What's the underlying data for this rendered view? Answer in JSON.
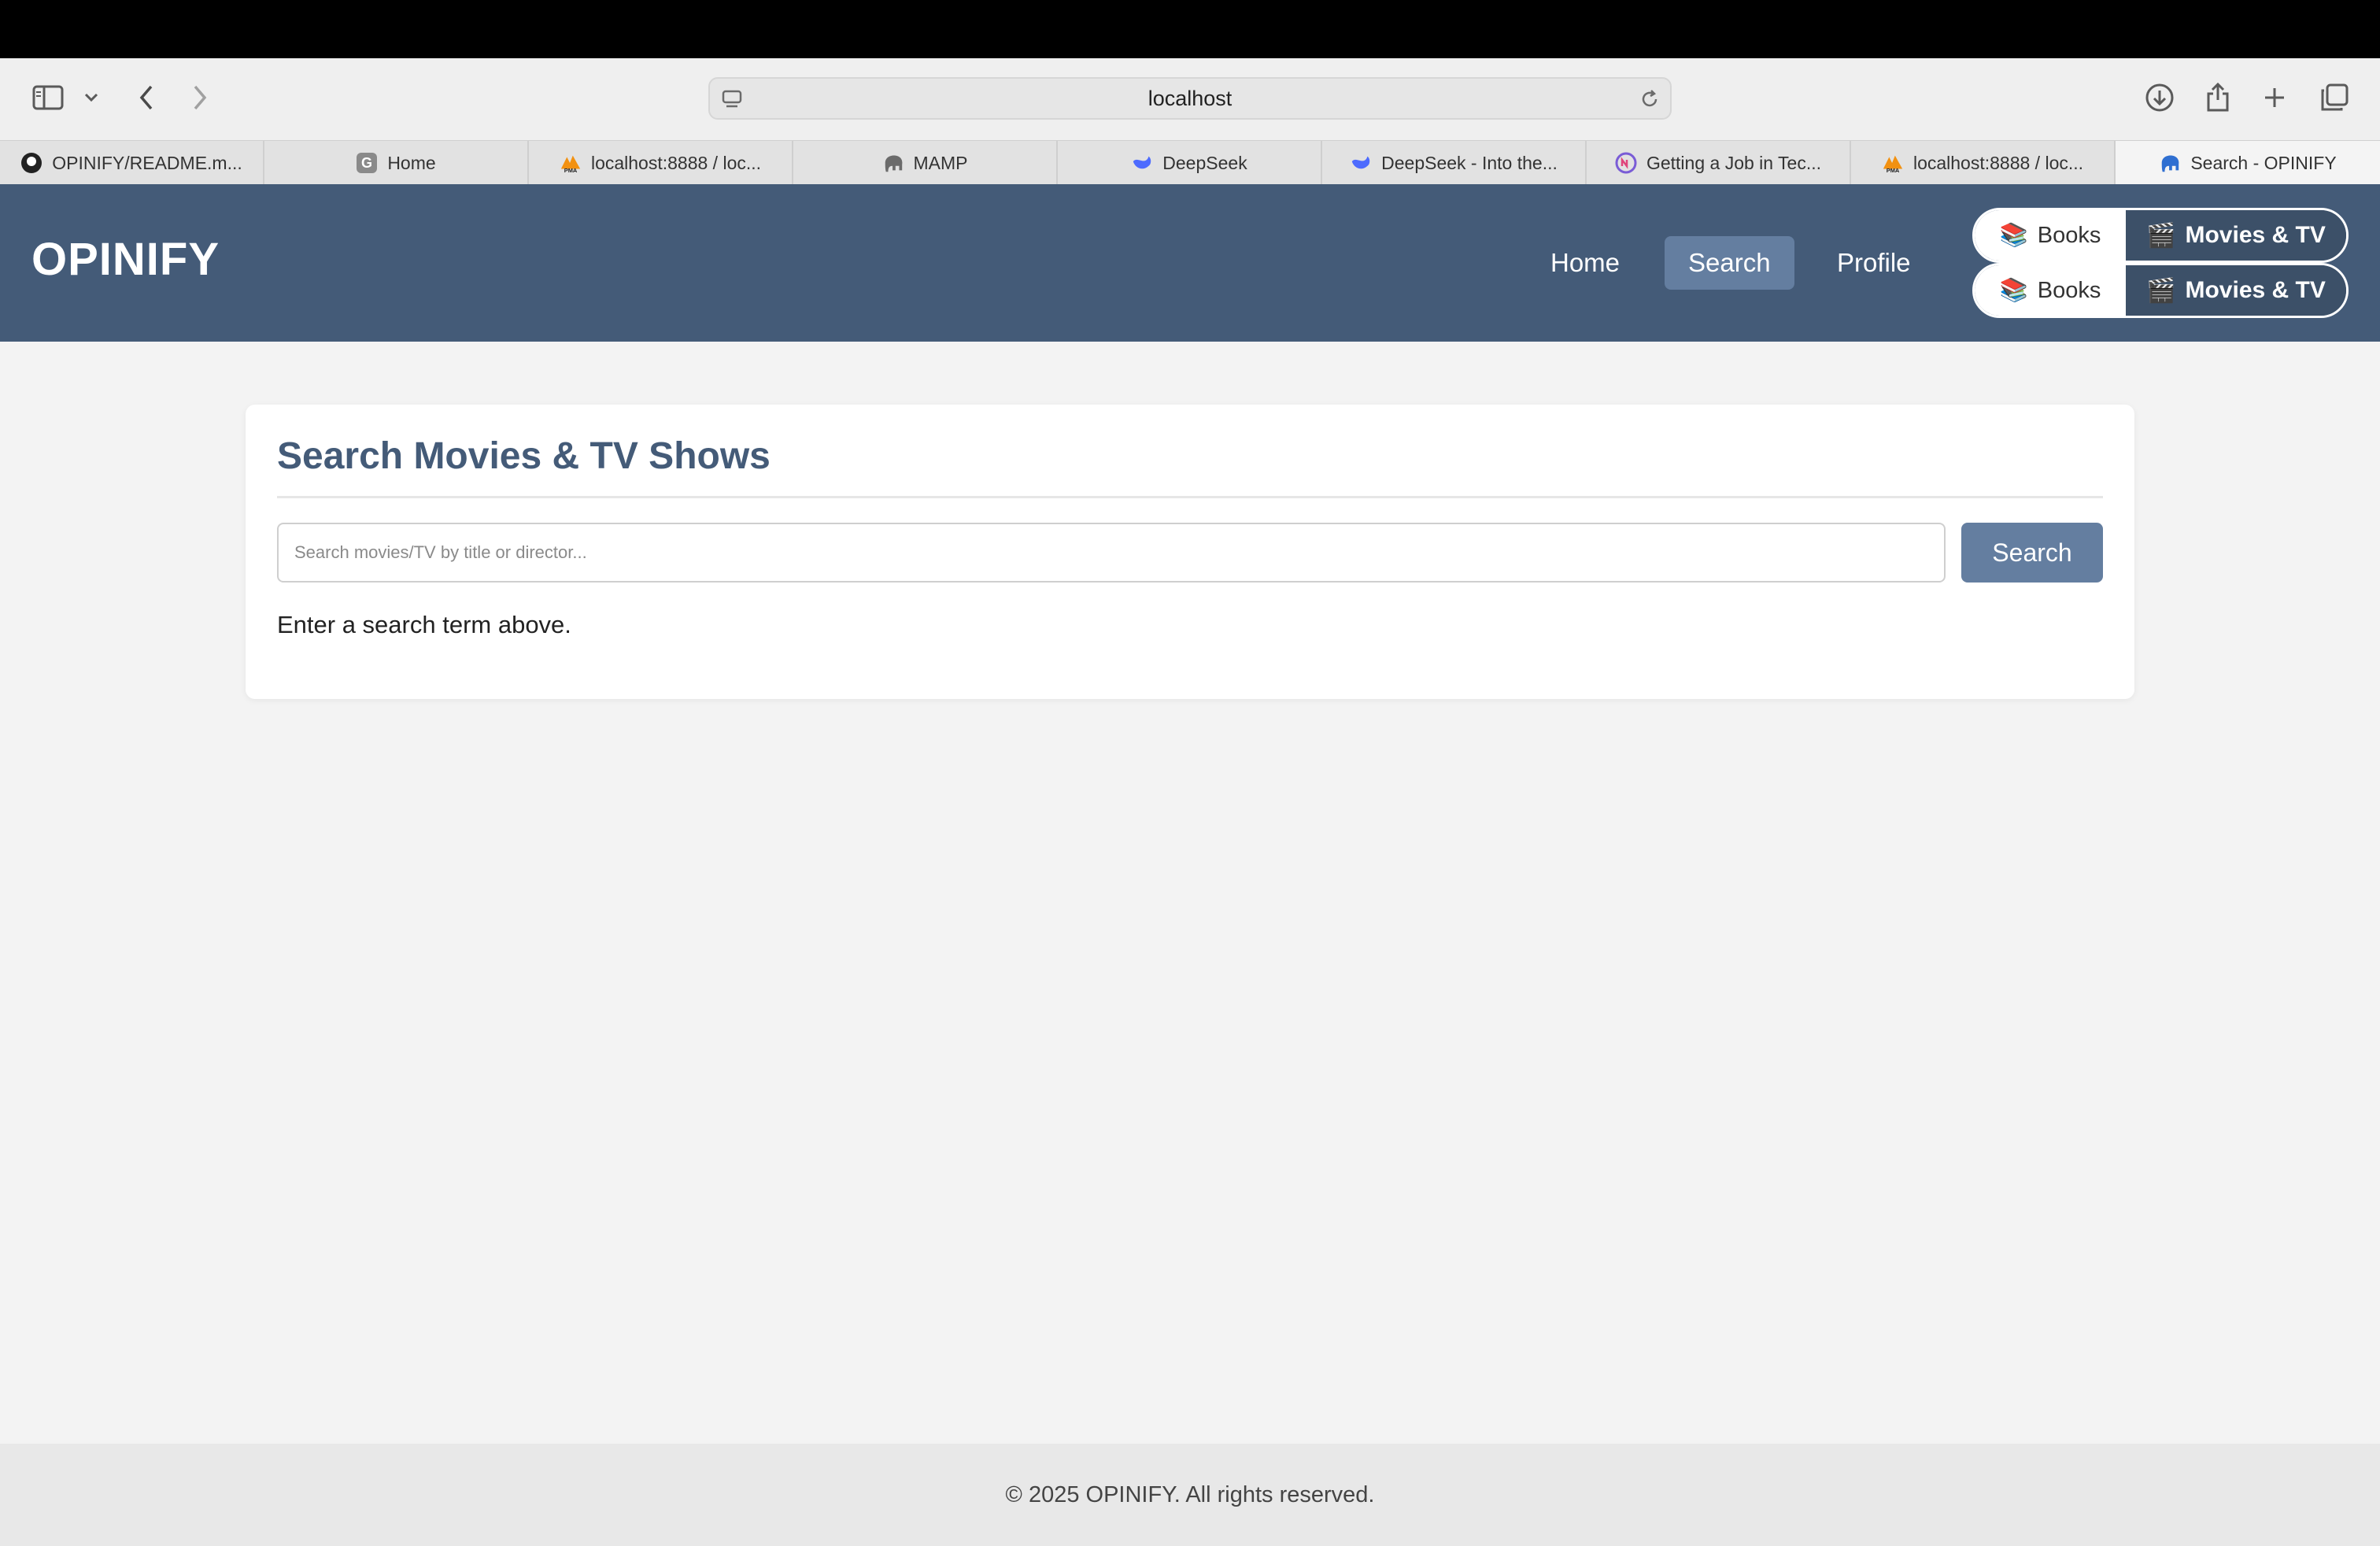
{
  "browser": {
    "url": "localhost",
    "tabs": [
      {
        "label": "OPINIFY/README.m...",
        "icon": "github-icon"
      },
      {
        "label": "Home",
        "icon": "g-icon"
      },
      {
        "label": "localhost:8888 / loc...",
        "icon": "phpmyadmin-icon"
      },
      {
        "label": "MAMP",
        "icon": "elephant-icon"
      },
      {
        "label": "DeepSeek",
        "icon": "deepseek-icon"
      },
      {
        "label": "DeepSeek - Into the...",
        "icon": "deepseek-icon"
      },
      {
        "label": "Getting a Job in Tec...",
        "icon": "nc-icon"
      },
      {
        "label": "localhost:8888 / loc...",
        "icon": "phpmyadmin-icon"
      },
      {
        "label": "Search - OPINIFY",
        "icon": "elephant-icon",
        "active": true
      }
    ]
  },
  "header": {
    "brand": "OPINIFY",
    "nav": {
      "home": "Home",
      "search": "Search",
      "profile": "Profile"
    },
    "toggle": {
      "books": "Books",
      "movies": "Movies & TV"
    },
    "colors": {
      "header_bg": "#445b78",
      "active_bg": "#647ea0"
    }
  },
  "main": {
    "title": "Search Movies & TV Shows",
    "search_placeholder": "Search movies/TV by title or director...",
    "search_button": "Search",
    "hint": "Enter a search term above."
  },
  "footer": {
    "text": "© 2025 OPINIFY. All rights reserved."
  }
}
